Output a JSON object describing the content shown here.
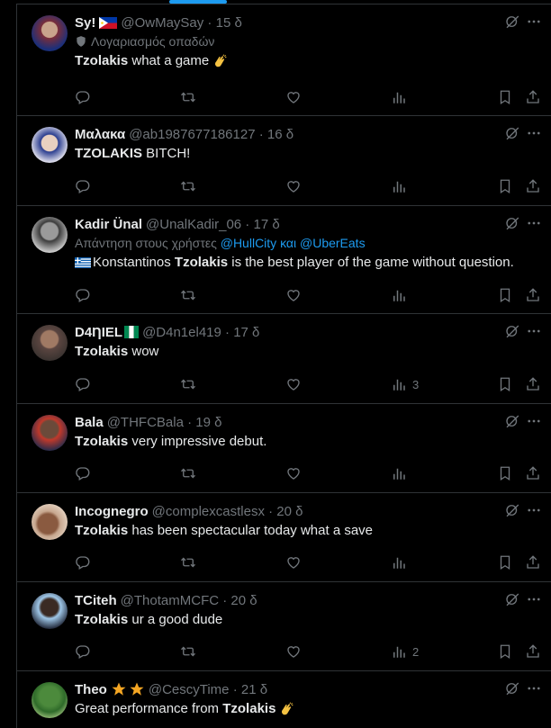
{
  "tweets": [
    {
      "name": "Sy!",
      "handle": "@OwMaySay",
      "time": "15 δ",
      "badge": "Λογαριασμός οπαδών",
      "text_bold": "Tzolakis",
      "text_rest": " what a game",
      "emoji": "clap",
      "views": ""
    },
    {
      "name": "Μαλακα",
      "handle": "@ab1987677186127",
      "time": "16 δ",
      "text_bold": "TZOLAKIS",
      "text_rest": " BITCH!",
      "views": ""
    },
    {
      "name": "Kadir Ünal",
      "handle": "@UnalKadir_06",
      "time": "17 δ",
      "reply_prefix": "Απάντηση στους χρήστες ",
      "reply_to1": "@HullCity",
      "reply_and": " και ",
      "reply_to2": "@UberEats",
      "text_pre": "Konstantinos ",
      "text_bold": "Tzolakis",
      "text_rest": " is the best player of the game without question.",
      "views": ""
    },
    {
      "name": "D4ȠIEL",
      "handle": "@D4n1el419",
      "time": "17 δ",
      "text_bold": "Tzolakis",
      "text_rest": " wow",
      "views": "3"
    },
    {
      "name": "Bala",
      "handle": "@THFCBala",
      "time": "19 δ",
      "text_bold": "Tzolakis",
      "text_rest": " very impressive debut.",
      "views": ""
    },
    {
      "name": "Incognegro",
      "handle": "@complexcastlesx",
      "time": "20 δ",
      "text_bold": "Tzolakis",
      "text_rest": " has been spectacular today what a save",
      "views": ""
    },
    {
      "name": "TCiteh",
      "handle": "@ThotamMCFC",
      "time": "20 δ",
      "text_bold": "Tzolakis",
      "text_rest": " ur a good dude",
      "views": "2"
    },
    {
      "name": "Theo",
      "handle": "@CescyTime",
      "time": "21 δ",
      "text_pre": "Great performance from ",
      "text_bold": "Tzolakis",
      "text_rest": "",
      "emoji": "clap",
      "views": ""
    }
  ],
  "colors": {
    "background": "#000000",
    "text": "#e7e9ea",
    "muted": "#71767b",
    "link": "#1d9bf0",
    "border": "#2f3336"
  }
}
